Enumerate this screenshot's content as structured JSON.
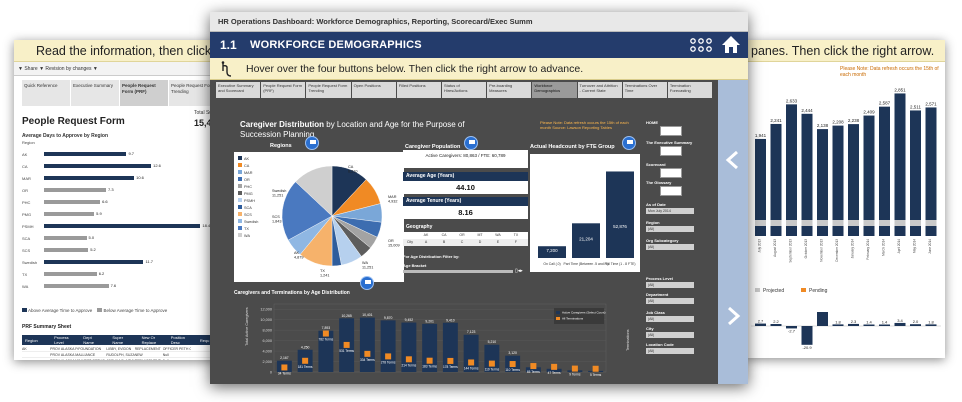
{
  "left_card": {
    "instruction": "Read the information, then click the HO",
    "toolbar": "▼ Share  ▼ Revision by changes ▼",
    "tabs": [
      "Quick Reference",
      "Executive Summary",
      "People Request Form (PRF)",
      "People Request Fom Trending"
    ],
    "title": "People Request Form",
    "total_label": "Total Subm",
    "total_value": "15,4",
    "chart_subtitle": "Average Days to Approve by Region",
    "bars": [
      {
        "label": "Region",
        "value": "",
        "v": 0,
        "below": false
      },
      {
        "label": "AK",
        "value": "9.7",
        "v": 9.7,
        "below": false
      },
      {
        "label": "CA",
        "value": "12.6",
        "v": 12.6,
        "below": false
      },
      {
        "label": "MAR",
        "value": "10.6",
        "v": 10.6,
        "below": false
      },
      {
        "label": "OR",
        "value": "7.3",
        "v": 7.3,
        "below": true
      },
      {
        "label": "PHC",
        "value": "6.6",
        "v": 6.6,
        "below": true
      },
      {
        "label": "PMG",
        "value": "5.9",
        "v": 5.9,
        "below": true
      },
      {
        "label": "PSMH",
        "value": "18.4",
        "v": 18.4,
        "below": false
      },
      {
        "label": "SCA",
        "value": "5.0",
        "v": 5.0,
        "below": true
      },
      {
        "label": "SCS",
        "value": "5.2",
        "v": 5.2,
        "below": true
      },
      {
        "label": "Swedish",
        "value": "11.7",
        "v": 11.7,
        "below": false
      },
      {
        "label": "TX",
        "value": "6.2",
        "v": 6.2,
        "below": true
      },
      {
        "label": "WA",
        "value": "7.6",
        "v": 7.6,
        "below": true
      }
    ],
    "legend": [
      "Above Average Time to Approve",
      "Below Average Time to Approve"
    ],
    "sheet_title": "PRF Summary Sheet",
    "table_headers": [
      "Region",
      "Process Level",
      "Dept Name",
      "Super Name",
      "New Or Replace",
      "Position Desc",
      "Requ"
    ],
    "table_rows": [
      [
        "AK",
        "PROV ALASKA FOUNDATION",
        "FOUNDATION",
        "LIBBY, EVIDON",
        "REPLACEMENT",
        "OFFICER PETH OR",
        ""
      ],
      [
        "",
        "PROV ALASKA MED CTR",
        "ALLIANCE",
        "RUDOLPH, SUZANNE",
        "NEW",
        "Null",
        ""
      ],
      [
        "",
        "PROV ALASKA MED CTR (HA)",
        "3 WEST ORTHO",
        "JOSHUA D. MEALE",
        "REPLACEMENT",
        "Null",
        ""
      ],
      [
        "",
        "",
        "",
        "MEALS",
        "REPLACEMENT",
        "RN NURSE ED",
        ""
      ]
    ]
  },
  "right_card": {
    "instruction": "panes. Then click the right arrow.",
    "note": "Please Note: Data refresh occurs the 15th of each month",
    "bar_values": [
      "1,941",
      "2,241",
      "2,633",
      "2,444",
      "2,138",
      "2,208",
      "2,238",
      "2,409",
      "2,587",
      "2,851",
      "2,511",
      "2,571"
    ],
    "bar_v": [
      1941,
      2241,
      2633,
      2444,
      2138,
      2208,
      2238,
      2409,
      2587,
      2851,
      2511,
      2571
    ],
    "months": [
      "July 2013",
      "August 2013",
      "September 2013",
      "October 2013",
      "November 2013",
      "December 2013",
      "January 2014",
      "February 2014",
      "March 2014",
      "April 2014",
      "May 2014",
      "June 2014"
    ],
    "legend": [
      "Projected",
      "Pending"
    ],
    "lower_values": [
      "2.7",
      "2.2",
      "-2.7",
      "-20.9",
      "16.1",
      "1.8",
      "2.3",
      "1.4",
      "1.4",
      "3.4",
      "2.0",
      "1.8"
    ],
    "lower_v": [
      2.7,
      2.2,
      -2.7,
      -20.9,
      16.1,
      1.8,
      2.3,
      1.4,
      1.4,
      3.4,
      2.0,
      1.8
    ]
  },
  "main": {
    "window_title": "HR Operations Dashboard: Workforce Demographics, Reporting, Scorecard/Exec Summ",
    "section_number": "1.1",
    "section_title": "WORKFORCE DEMOGRAPHICS",
    "instruction": "Hover over the four buttons below. Then click the right arrow to advance.",
    "tabs": [
      "Executive Summary and Scorecard",
      "People Request Form (PRF)",
      "People Request Form Trending",
      "Open Positions",
      "Filled Positions",
      "Status of Hires/Actions",
      "Pre-boarding Measures",
      "Workforce Demographics",
      "Turnover and Attrition - Current State",
      "Terminations Over Time",
      "Termination Forecasting"
    ],
    "active_tab": 7,
    "heading_bold": "Caregiver Distribution",
    "heading_rest": " by Location and Age for the Purpose of Succession Planning",
    "note": "Please Note: Data refresh occurs the 15th of each month Source: Lawson Reporting Tables",
    "regions_label": "Regions",
    "region_legend": [
      "AK",
      "CA",
      "MAR",
      "OR",
      "PHC",
      "PMG",
      "PSMH",
      "SCA",
      "SCS",
      "Swedish",
      "TX",
      "WA"
    ],
    "pie_labels": [
      "CA 6,210",
      "MAR 4,932",
      "OR 15,009",
      "Swedish 11,251",
      "AK 4,879",
      "SCS 1,843",
      "TX 1,241",
      "WA 11,251"
    ],
    "pop_label": "Caregiver Population",
    "active_caregivers": "Active Caregivers: 80,863 / FTE: 60,789",
    "avg_age_label": "Average Age (Years)",
    "avg_age_value": "44.10",
    "avg_tenure_label": "Average Tenure (Years)",
    "avg_tenure_value": "8.16",
    "geography_label": "Geography",
    "geo_headers": [
      "AK",
      "CA",
      "OR",
      "MT",
      "WA",
      "TX"
    ],
    "geo_row": [
      "City",
      "A",
      "B",
      "C",
      "D",
      "E",
      "F"
    ],
    "age_filter_label": "For Age Distribution Filter by:",
    "age_bracket_label": "Age Bracket",
    "hc_label": "Actual Headcount by FTE Group",
    "hc_values": [
      "7,200",
      "21,204",
      "52,876"
    ],
    "hc_v": [
      7200,
      21204,
      52876
    ],
    "hc_categories": [
      "On Call (.0)",
      "Part Time (Between .5 and .9)",
      "Full Time (1 - 8 FTE)"
    ],
    "filters": [
      {
        "label": "HOME",
        "value": ""
      },
      {
        "label": "The Executive Summary",
        "value": ""
      },
      {
        "label": "Scorecard",
        "value": ""
      },
      {
        "label": "The Glossary",
        "value": ""
      },
      {
        "label": "As of Date",
        "value": "Mon July 2014"
      },
      {
        "label": "Region",
        "value": "(All)"
      },
      {
        "label": "Org Subcategory",
        "value": "(All)"
      },
      {
        "label": "Process Level",
        "value": "(All)"
      },
      {
        "label": "Department",
        "value": "(All)"
      },
      {
        "label": "Job Class",
        "value": "(All)"
      },
      {
        "label": "City",
        "value": "(All)"
      },
      {
        "label": "Location Code",
        "value": "(All)"
      }
    ],
    "age_title": "Caregivers and Terminations by Age Distribution",
    "age_ylabel": "Total Active Caregivers",
    "age_y2label": "Terminations",
    "age_legend": [
      "Active Caregivers (Select Count)",
      "All Terminations"
    ],
    "age_yticks": [
      "0",
      "2,000",
      "4,000",
      "6,000",
      "8,000",
      "10,000",
      "12,000"
    ],
    "age_ymax": 13000,
    "age_values": [
      2167,
      4250,
      7893,
      10265,
      10401,
      9870,
      9452,
      9201,
      9410,
      7123,
      5210,
      3120,
      902,
      611,
      316,
      212
    ],
    "age_term_labels": [
      "34 Terms",
      "181 Terms",
      "782 Terms",
      "531 Terms",
      "334 Terms",
      "278 Terms",
      "214 Terms",
      "183 Terms",
      "178 Terms",
      "144 Terms",
      "119 Terms",
      "110 Terms",
      "65 Terms",
      "47 Terms",
      "9 Terms",
      "5 Terms"
    ],
    "age_term_v": [
      34,
      181,
      782,
      531,
      334,
      278,
      214,
      183,
      178,
      144,
      119,
      110,
      65,
      47,
      9,
      5
    ],
    "age_val_labels": [
      "2,167",
      "4,250",
      "7,893",
      "10,265",
      "10,401",
      "9,870",
      "9,452",
      "9,201",
      "9,410",
      "7,123",
      "5,210",
      "3,120",
      "902",
      "611",
      "316",
      "212"
    ],
    "colors": {
      "navy": "#1d3557",
      "orange": "#f08a24",
      "section_bar": "#243c6c",
      "panel": "#a9bdd9"
    }
  }
}
